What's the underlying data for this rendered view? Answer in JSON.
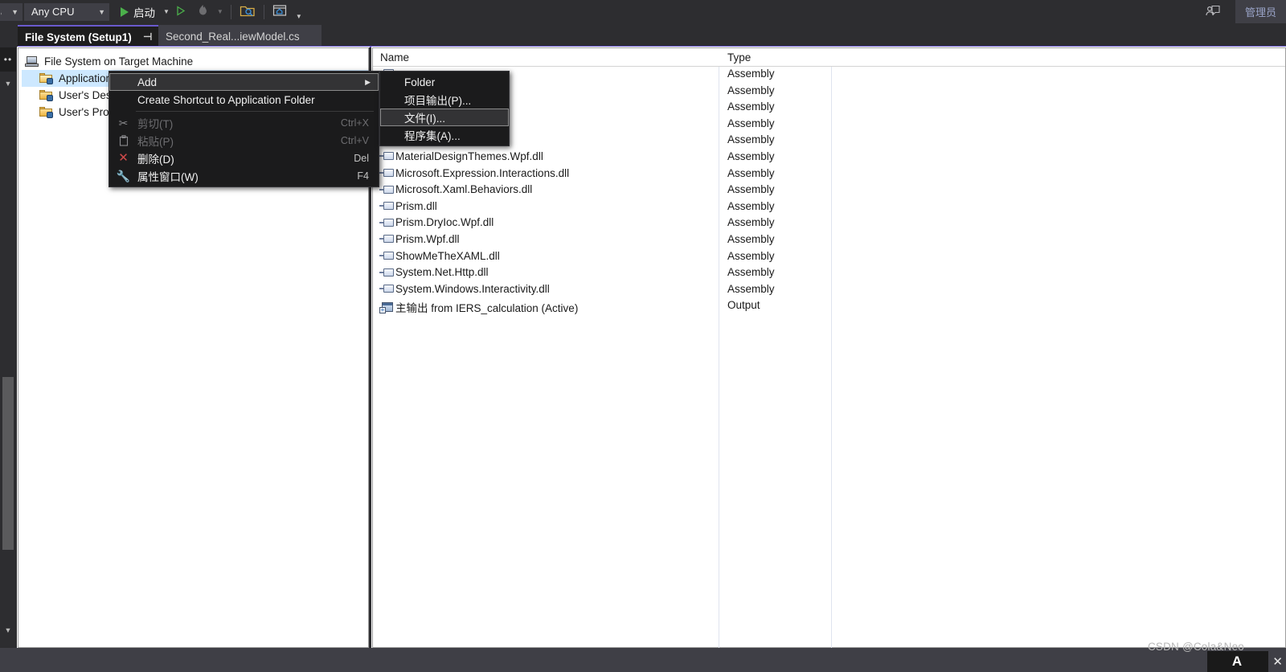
{
  "toolbar": {
    "configuration": {
      "value": "ase",
      "arrow": "chevron-down-icon"
    },
    "platform": {
      "value": "Any CPU",
      "arrow": "chevron-down-icon"
    },
    "run_label": "启动",
    "run_arrow": "chevron-down-icon",
    "attach_arrow": "chevron-down-icon",
    "admin_label": "管理员"
  },
  "tabs": {
    "active": {
      "label": "File System (Setup1)",
      "pin": "⊣",
      "close": "✕"
    },
    "inactive": {
      "label": "Second_Real...iewModel.cs"
    },
    "strip_close": "✕",
    "overflow": "▼",
    "gear": "⚙"
  },
  "tree": {
    "root": {
      "label": "File System on Target Machine",
      "icon": "computer-icon"
    },
    "items": [
      {
        "label": "Application Folder",
        "icon": "folder-open-icon",
        "selected": true
      },
      {
        "label": "User's Desktop",
        "icon": "folder-icon",
        "selected": false
      },
      {
        "label": "User's Programs Menu",
        "icon": "folder-icon",
        "selected": false
      }
    ]
  },
  "list": {
    "columns": [
      "Name",
      "Type"
    ],
    "rows": [
      {
        "name": "",
        "type": "Assembly",
        "icon": "dll-icon",
        "hidden_name": true
      },
      {
        "name": "",
        "type": "Assembly",
        "icon": "dll-icon",
        "hidden_name": true
      },
      {
        "name": "",
        "type": "Assembly",
        "icon": "dll-icon",
        "hidden_name": true
      },
      {
        "name": "",
        "type": "Assembly",
        "icon": "dll-icon",
        "hidden_name": true
      },
      {
        "name": "",
        "type": "Assembly",
        "icon": "dll-icon",
        "hidden_name": true
      },
      {
        "name": "MaterialDesignThemes.Wpf.dll",
        "type": "Assembly",
        "icon": "dll-icon"
      },
      {
        "name": "Microsoft.Expression.Interactions.dll",
        "type": "Assembly",
        "icon": "dll-icon"
      },
      {
        "name": "Microsoft.Xaml.Behaviors.dll",
        "type": "Assembly",
        "icon": "dll-icon"
      },
      {
        "name": "Prism.dll",
        "type": "Assembly",
        "icon": "dll-icon"
      },
      {
        "name": "Prism.DryIoc.Wpf.dll",
        "type": "Assembly",
        "icon": "dll-icon"
      },
      {
        "name": "Prism.Wpf.dll",
        "type": "Assembly",
        "icon": "dll-icon"
      },
      {
        "name": "ShowMeTheXAML.dll",
        "type": "Assembly",
        "icon": "dll-icon"
      },
      {
        "name": "System.Net.Http.dll",
        "type": "Assembly",
        "icon": "dll-icon"
      },
      {
        "name": "System.Windows.Interactivity.dll",
        "type": "Assembly",
        "icon": "dll-icon"
      },
      {
        "name": "主输出 from IERS_calculation (Active)",
        "type": "Output",
        "icon": "project-output-icon"
      }
    ]
  },
  "context_menu": {
    "items": [
      {
        "label": "Add",
        "shortcut": "",
        "submenu": true,
        "highlighted": true,
        "disabled": false,
        "icon": ""
      },
      {
        "label": "Create Shortcut to Application Folder",
        "shortcut": "",
        "submenu": false,
        "highlighted": false,
        "disabled": false,
        "icon": ""
      },
      {
        "separator": true
      },
      {
        "label": "剪切(T)",
        "shortcut": "Ctrl+X",
        "submenu": false,
        "highlighted": false,
        "disabled": true,
        "icon": "scissors-icon"
      },
      {
        "label": "粘贴(P)",
        "shortcut": "Ctrl+V",
        "submenu": false,
        "highlighted": false,
        "disabled": true,
        "icon": "clipboard-icon"
      },
      {
        "label": "删除(D)",
        "shortcut": "Del",
        "submenu": false,
        "highlighted": false,
        "disabled": false,
        "icon": "delete-x-icon"
      },
      {
        "label": "属性窗口(W)",
        "shortcut": "F4",
        "submenu": false,
        "highlighted": false,
        "disabled": false,
        "icon": "wrench-icon"
      }
    ],
    "submenu_items": [
      {
        "label": "Folder",
        "highlighted": false
      },
      {
        "label": "项目输出(P)...",
        "highlighted": false
      },
      {
        "label": "文件(I)...",
        "highlighted": true
      },
      {
        "label": "程序集(A)...",
        "highlighted": false
      }
    ]
  },
  "statusbar": {
    "watermark": "CSDN @Cola&Neo",
    "logo": "A",
    "close": "✕"
  },
  "colors": {
    "accent": "#6a5acd",
    "chrome": "#2d2d30",
    "panel": "#1b1b1c",
    "selection": "#cde8ff",
    "run_green": "#4bb04b"
  }
}
